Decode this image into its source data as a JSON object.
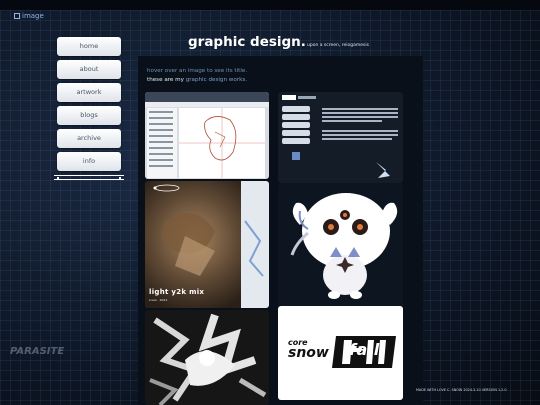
{
  "header": {
    "logo_alt": "image"
  },
  "nav": {
    "items": [
      {
        "label": "home"
      },
      {
        "label": "about"
      },
      {
        "label": "artwork"
      },
      {
        "label": "blogs"
      },
      {
        "label": "archive"
      },
      {
        "label": "info"
      }
    ]
  },
  "page": {
    "title": "graphic design.",
    "subtitle": "upon a screen, reiogamesis"
  },
  "intro": {
    "hint": "hover over an image to see its title.",
    "lead": "these are my ",
    "accent": "graphic design works."
  },
  "gallery": {
    "mix_label": "light y2k mix",
    "mix_sub": "snow · 2024",
    "snowfall_top": "core",
    "snowfall_mid": "snow",
    "snowfall_big": "fall"
  },
  "background": {
    "watermark": "PARASITE"
  },
  "footer": {
    "text": "MADE WITH LOVE C. SNOW 2024.3.10 VERSION 1.2.0"
  },
  "colors": {
    "background": "#0d1726",
    "panel": "#0a1019",
    "nav_button": "#ffffff",
    "accent_text": "#7f9fcc"
  }
}
